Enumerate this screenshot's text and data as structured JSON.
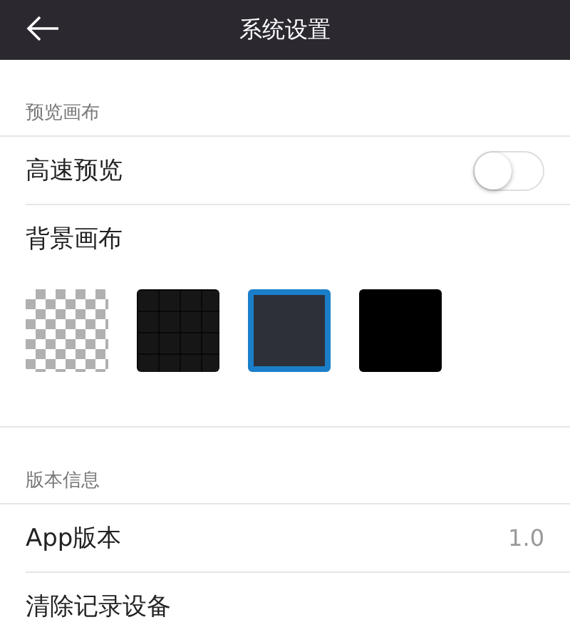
{
  "header": {
    "title": "系统设置"
  },
  "sections": [
    {
      "title": "预览画布",
      "rows": [
        {
          "kind": "toggle",
          "label": "高速预览",
          "on": false
        },
        {
          "kind": "swatches",
          "label": "背景画布",
          "swatches": [
            {
              "kind": "checker",
              "selected": false
            },
            {
              "kind": "grid",
              "color": "#161616",
              "selected": false
            },
            {
              "kind": "plain",
              "color": "#2e3039",
              "selected": true
            },
            {
              "kind": "plain",
              "color": "#000000",
              "selected": false
            }
          ]
        }
      ]
    },
    {
      "title": "版本信息",
      "rows": [
        {
          "kind": "value",
          "label": "App版本",
          "value": "1.0"
        },
        {
          "kind": "plain",
          "label": "清除记录设备"
        }
      ]
    }
  ]
}
